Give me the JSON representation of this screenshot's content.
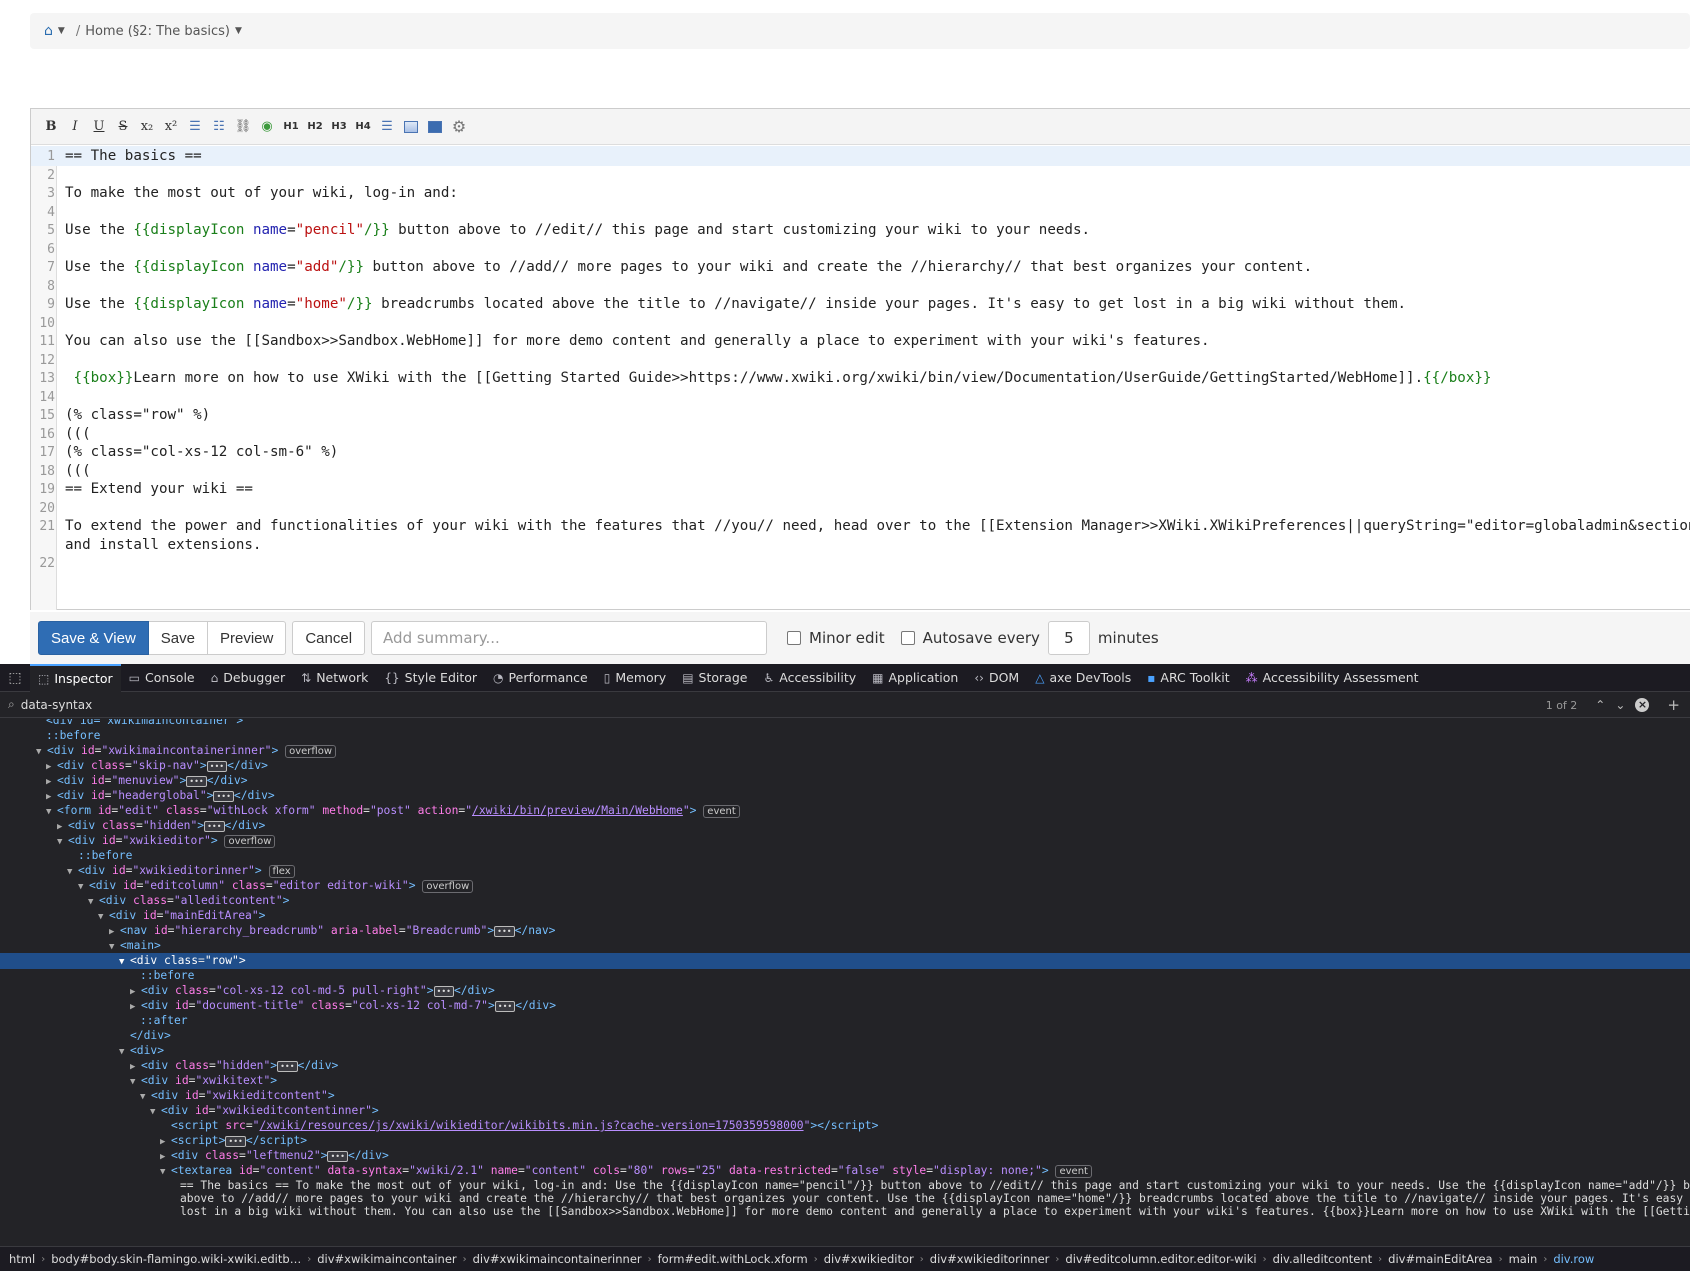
{
  "breadcrumb": {
    "home_icon": "home-icon",
    "page_label": "Home (§2: The basics)",
    "separator": "/"
  },
  "toolbar": {
    "buttons": [
      {
        "id": "bold",
        "glyph": "B"
      },
      {
        "id": "italic",
        "glyph": "I"
      },
      {
        "id": "underline",
        "glyph": "U"
      },
      {
        "id": "strikethrough",
        "glyph": "S"
      },
      {
        "id": "subscript",
        "glyph": "x₂"
      },
      {
        "id": "superscript",
        "glyph": "x²"
      },
      {
        "id": "bulleted-list",
        "glyph": "☰"
      },
      {
        "id": "numbered-list",
        "glyph": "☷"
      },
      {
        "id": "link",
        "glyph": "⛓"
      },
      {
        "id": "image",
        "glyph": "◉"
      },
      {
        "id": "h1",
        "glyph": "H1"
      },
      {
        "id": "h2",
        "glyph": "H2"
      },
      {
        "id": "h3",
        "glyph": "H3"
      },
      {
        "id": "h4",
        "glyph": "H4"
      },
      {
        "id": "horizontal-rule",
        "glyph": "☰"
      },
      {
        "id": "table",
        "glyph": ""
      },
      {
        "id": "html",
        "glyph": ""
      },
      {
        "id": "macro",
        "glyph": "⚙"
      }
    ]
  },
  "editor": {
    "lines": [
      {
        "n": "1",
        "text": "== The basics =="
      },
      {
        "n": "2",
        "text": ""
      },
      {
        "n": "3",
        "text": "To make the most out of your wiki, log-in and:"
      },
      {
        "n": "4",
        "text": ""
      },
      {
        "n": "5",
        "text": "Use the {{displayIcon name=\"pencil\"/}} button above to //edit// this page and start customizing your wiki to your needs."
      },
      {
        "n": "6",
        "text": ""
      },
      {
        "n": "7",
        "text": "Use the {{displayIcon name=\"add\"/}} button above to //add// more pages to your wiki and create the //hierarchy// that best organizes your content."
      },
      {
        "n": "8",
        "text": ""
      },
      {
        "n": "9",
        "text": "Use the {{displayIcon name=\"home\"/}} breadcrumbs located above the title to //navigate// inside your pages. It's easy to get lost in a big wiki without them."
      },
      {
        "n": "10",
        "text": ""
      },
      {
        "n": "11",
        "text": "You can also use the [[Sandbox>>Sandbox.WebHome]] for more demo content and generally a place to experiment with your wiki's features."
      },
      {
        "n": "12",
        "text": ""
      },
      {
        "n": "13",
        "text": " {{box}}Learn more on how to use XWiki with the [[Getting Started Guide>>https://www.xwiki.org/xwiki/bin/view/Documentation/UserGuide/GettingStarted/WebHome]].{{/box}}"
      },
      {
        "n": "14",
        "text": ""
      },
      {
        "n": "15",
        "text": "(% class=\"row\" %)"
      },
      {
        "n": "16",
        "text": "((("
      },
      {
        "n": "17",
        "text": "(% class=\"col-xs-12 col-sm-6\" %)"
      },
      {
        "n": "18",
        "text": "((("
      },
      {
        "n": "19",
        "text": "== Extend your wiki =="
      },
      {
        "n": "20",
        "text": ""
      },
      {
        "n": "21",
        "text": "To extend the power and functionalities of your wiki with the features that //you// need, head over to the [[Extension Manager>>XWiki.XWikiPreferences||queryString=\"editor=globaladmin&section=XW"
      },
      {
        "n": "",
        "text": "and install extensions."
      },
      {
        "n": "22",
        "text": ""
      }
    ]
  },
  "actions": {
    "save_view": "Save & View",
    "save": "Save",
    "preview": "Preview",
    "cancel": "Cancel",
    "summary_placeholder": "Add summary...",
    "minor_edit": "Minor edit",
    "autosave": "Autosave",
    "every": "every",
    "autosave_minutes": "5",
    "minutes": "minutes"
  },
  "devtools": {
    "tabs": [
      {
        "label": "Inspector",
        "icon": "inspector-icon",
        "glyph": "⬚",
        "active": true
      },
      {
        "label": "Console",
        "icon": "console-icon",
        "glyph": "▭"
      },
      {
        "label": "Debugger",
        "icon": "debugger-icon",
        "glyph": "⌂"
      },
      {
        "label": "Network",
        "icon": "network-icon",
        "glyph": "⇅"
      },
      {
        "label": "Style Editor",
        "icon": "style-editor-icon",
        "glyph": "{}"
      },
      {
        "label": "Performance",
        "icon": "performance-icon",
        "glyph": "◔"
      },
      {
        "label": "Memory",
        "icon": "memory-icon",
        "glyph": "▯"
      },
      {
        "label": "Storage",
        "icon": "storage-icon",
        "glyph": "▤"
      },
      {
        "label": "Accessibility",
        "icon": "accessibility-icon",
        "glyph": "♿"
      },
      {
        "label": "Application",
        "icon": "application-icon",
        "glyph": "▦"
      },
      {
        "label": "DOM",
        "icon": "dom-icon",
        "glyph": "‹›"
      },
      {
        "label": "axe DevTools",
        "icon": "axe-icon",
        "glyph": "△"
      },
      {
        "label": "ARC Toolkit",
        "icon": "arc-icon",
        "glyph": "▪"
      },
      {
        "label": "Accessibility Assessment",
        "icon": "assessment-icon",
        "glyph": "⁂"
      }
    ],
    "search_value": "data-syntax",
    "search_count": "1 of 2",
    "footer_crumbs": [
      "html",
      "body#body.skin-flamingo.wiki-xwiki.editb…",
      "div#xwikimaincontainer",
      "div#xwikimaincontainerinner",
      "form#edit.withLock.xform",
      "div#xwikieditor",
      "div#xwikieditorinner",
      "div#editcolumn.editor.editor-wiki",
      "div.alleditcontent",
      "div#mainEditArea",
      "main",
      "div.row"
    ]
  }
}
